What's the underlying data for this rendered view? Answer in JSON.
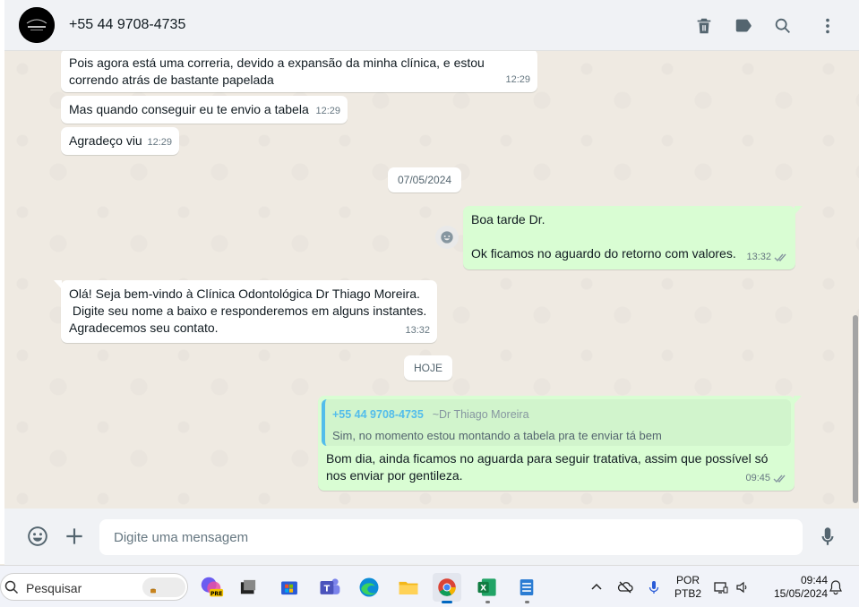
{
  "header": {
    "contact_name": "+55 44 9708-4735",
    "icons": [
      "trash-icon",
      "label-icon",
      "search-icon",
      "menu-icon"
    ]
  },
  "messages": [
    {
      "dir": "in",
      "text": "Pois agora está uma correria, devido a expansão da minha clínica, e estou\ncorrendo atrás de bastante papelada",
      "time": "12:29"
    },
    {
      "dir": "in",
      "text": "Mas quando conseguir eu te envio a tabela",
      "time": "12:29"
    },
    {
      "dir": "in",
      "text": "Agradeço viu",
      "time": "12:29"
    },
    {
      "date_chip": "07/05/2024"
    },
    {
      "dir": "out",
      "text": "Boa tarde Dr.\n\nOk ficamos no aguardo do retorno com valores.",
      "time": "13:32",
      "ticks": "read"
    },
    {
      "dir": "in",
      "text": "Olá! Seja bem-vindo à Clínica Odontológica Dr Thiago Moreira.\n Digite seu nome a baixo e responderemos em alguns instantes.\nAgradecemos seu contato.",
      "time": "13:32"
    },
    {
      "date_chip": "HOJE"
    },
    {
      "dir": "out",
      "quote": {
        "phone": "+55 44 9708-4735",
        "author": "~Dr Thiago Moreira",
        "text": "Sim, no momento estou montando a tabela pra te enviar tá bem"
      },
      "text": "Bom dia, ainda ficamos no aguarda para seguir tratativa, assim que possível só\nnos enviar por gentileza.",
      "time": "09:45",
      "ticks": "read"
    }
  ],
  "composer": {
    "placeholder": "Digite uma mensagem"
  },
  "taskbar": {
    "search_label": "Pesquisar",
    "language": "POR",
    "keyboard": "PTB2",
    "time": "09:44",
    "date": "15/05/2024",
    "copilot_badge": "PRE"
  },
  "colors": {
    "outgoing_bubble": "#d9fdd3",
    "incoming_bubble": "#ffffff",
    "chat_bg": "#efeae2",
    "read_ticks": "#8696a0",
    "quote_accent": "#53bdeb"
  }
}
